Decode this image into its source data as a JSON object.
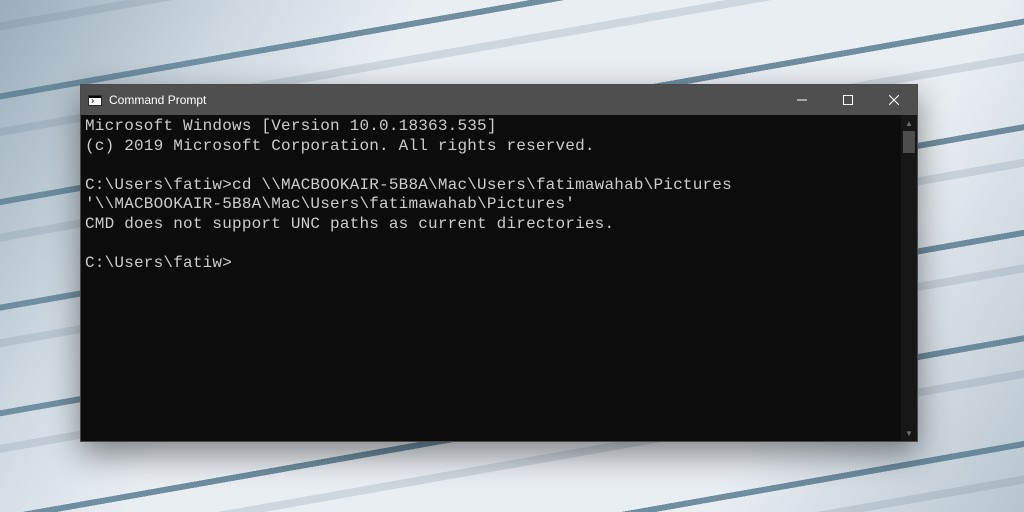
{
  "window": {
    "title": "Command Prompt"
  },
  "terminal": {
    "lines": {
      "l0": "Microsoft Windows [Version 10.0.18363.535]",
      "l1": "(c) 2019 Microsoft Corporation. All rights reserved.",
      "l2": "",
      "l3": "C:\\Users\\fatiw>cd \\\\MACBOOKAIR-5B8A\\Mac\\Users\\fatimawahab\\Pictures",
      "l4": "'\\\\MACBOOKAIR-5B8A\\Mac\\Users\\fatimawahab\\Pictures'",
      "l5": "CMD does not support UNC paths as current directories.",
      "l6": "",
      "l7": "C:\\Users\\fatiw>"
    }
  }
}
